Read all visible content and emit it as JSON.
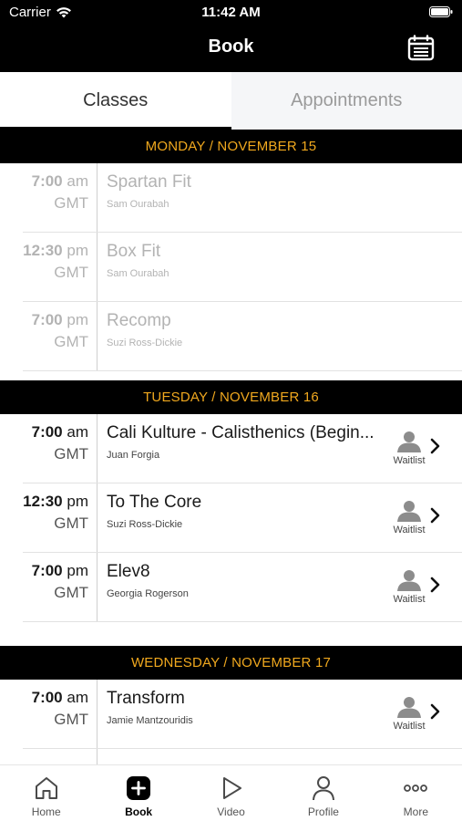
{
  "status_bar": {
    "carrier": "Carrier",
    "time": "11:42 AM"
  },
  "header": {
    "title": "Book",
    "calendar_icon": "calendar-icon"
  },
  "segments": {
    "classes": "Classes",
    "appointments": "Appointments",
    "selected": "Classes"
  },
  "days": [
    {
      "label": "MONDAY / NOVEMBER 15",
      "classes": [
        {
          "time": "7:00",
          "ampm": "am",
          "tz": "GMT",
          "name": "Spartan Fit",
          "instructor": "Sam Ourabah",
          "state": "past"
        },
        {
          "time": "12:30",
          "ampm": "pm",
          "tz": "GMT",
          "name": "Box Fit",
          "instructor": "Sam Ourabah",
          "state": "past"
        },
        {
          "time": "7:00",
          "ampm": "pm",
          "tz": "GMT",
          "name": "Recomp",
          "instructor": "Suzi Ross-Dickie",
          "state": "past"
        }
      ]
    },
    {
      "label": "TUESDAY / NOVEMBER 16",
      "classes": [
        {
          "time": "7:00",
          "ampm": "am",
          "tz": "GMT",
          "name": "Cali Kulture - Calisthenics  (Begin...",
          "instructor": "Juan Forgia",
          "state": "waitlist",
          "action": "Waitlist"
        },
        {
          "time": "12:30",
          "ampm": "pm",
          "tz": "GMT",
          "name": "To The Core",
          "instructor": "Suzi Ross-Dickie",
          "state": "waitlist",
          "action": "Waitlist"
        },
        {
          "time": "7:00",
          "ampm": "pm",
          "tz": "GMT",
          "name": "Elev8",
          "instructor": "Georgia Rogerson",
          "state": "waitlist",
          "action": "Waitlist"
        }
      ]
    },
    {
      "label": "WEDNESDAY / NOVEMBER 17",
      "classes": [
        {
          "time": "7:00",
          "ampm": "am",
          "tz": "GMT",
          "name": "Transform",
          "instructor": "Jamie Mantzouridis",
          "state": "waitlist",
          "action": "Waitlist"
        }
      ]
    }
  ],
  "tab_bar": {
    "items": [
      {
        "label": "Home",
        "icon": "home-icon"
      },
      {
        "label": "Book",
        "icon": "plus-square-icon"
      },
      {
        "label": "Video",
        "icon": "play-icon"
      },
      {
        "label": "Profile",
        "icon": "person-icon"
      },
      {
        "label": "More",
        "icon": "more-dots-icon"
      }
    ],
    "selected": "Book"
  }
}
